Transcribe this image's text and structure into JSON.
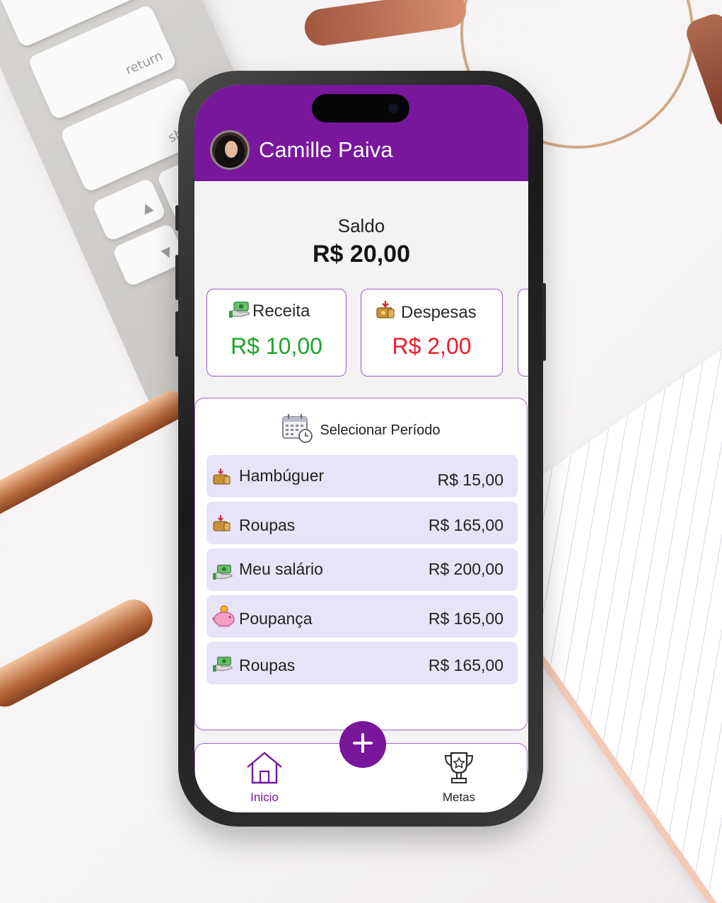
{
  "header": {
    "user_name": "Camille Paiva"
  },
  "balance": {
    "label": "Saldo",
    "value": "R$ 20,00"
  },
  "summary": [
    {
      "label": "Receita",
      "value": "R$ 10,00",
      "color": "#19a52a",
      "icon": "income-money-icon"
    },
    {
      "label": "Despesas",
      "value": "R$ 2,00",
      "color": "#f2182a",
      "icon": "expense-money-icon"
    }
  ],
  "period": {
    "label": "Selecionar Período",
    "icon": "calendar-clock-icon"
  },
  "transactions": [
    {
      "description": "Hambúguer",
      "amount": "R$ 15,00",
      "icon": "expense-money-icon"
    },
    {
      "description": "Roupas",
      "amount": "R$ 165,00",
      "icon": "expense-money-icon"
    },
    {
      "description": "Meu salário",
      "amount": "R$ 200,00",
      "icon": "income-money-icon"
    },
    {
      "description": "Poupança",
      "amount": "R$ 165,00",
      "icon": "piggy-bank-icon"
    },
    {
      "description": "Roupas",
      "amount": "R$ 165,00",
      "icon": "income-money-icon"
    }
  ],
  "nav": {
    "home_label": "Inicio",
    "goals_label": "Metas",
    "add_icon": "plus-icon",
    "active_color": "#78169c"
  },
  "colors": {
    "brand": "#78169c",
    "row_bg": "#e7e3f8",
    "border": "#a566c7"
  }
}
